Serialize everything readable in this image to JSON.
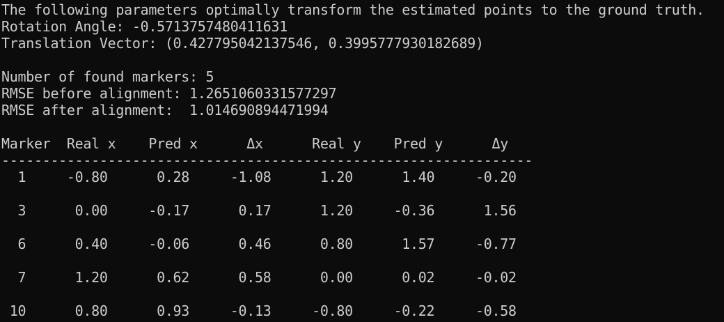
{
  "terminal": {
    "intro": "The following parameters optimally transform the estimated points to the ground truth.",
    "rotation_line": "Rotation Angle: -0.5713757480411631",
    "translation_line": "Translation Vector: (0.427795042137546, 0.3995777930182689)",
    "markers_found_line": "Number of found markers: 5",
    "rmse_before_line": "RMSE before alignment: 1.2651060331577297",
    "rmse_after_line": "RMSE after alignment:  1.014690894471994",
    "table_header": "Marker  Real x    Pred x      Δx      Real y    Pred y      Δy",
    "table_separator": "-----------------------------------------------------------------",
    "table_rows": [
      "  1     -0.80      0.28     -1.08      1.20      1.40     -0.20",
      "  3      0.00     -0.17      0.17      1.20     -0.36      1.56",
      "  6      0.40     -0.06      0.46      0.80      1.57     -0.77",
      "  7      1.20      0.62      0.58      0.00      0.02     -0.02",
      " 10      0.80      0.93     -0.13     -0.80     -0.22     -0.58"
    ]
  },
  "colors": {
    "background": "#0c0c0c",
    "foreground": "#cccccc"
  }
}
